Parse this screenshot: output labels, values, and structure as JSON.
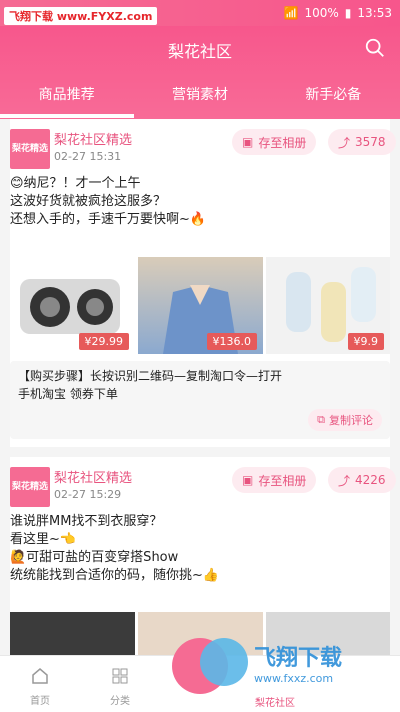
{
  "watermark": "飞翔下载 www.FYXZ.com",
  "status": {
    "battery": "100%",
    "time": "13:53"
  },
  "header": {
    "title": "梨花社区"
  },
  "tabs": [
    {
      "label": "商品推荐"
    },
    {
      "label": "营销素材"
    },
    {
      "label": "新手必备"
    }
  ],
  "posts": [
    {
      "logo": "梨花精选",
      "name": "梨花社区精选",
      "time": "02-27 15:31",
      "save_label": "存至相册",
      "share_count": "3578",
      "text_lines": [
        "😊纳尼？！才一个上午",
        "这波好货就被疯抢这服多？",
        "还想入手的，手速千万要快啊~🔥"
      ],
      "prices": [
        "¥29.99",
        "¥136.0",
        "¥9.9"
      ],
      "steps_line1": "【购买步骤】长按识别二维码—复制淘口令—打开",
      "steps_line2": "手机淘宝 领券下单",
      "copy_comment": "复制评论"
    },
    {
      "logo": "梨花精选",
      "name": "梨花社区精选",
      "time": "02-27 15:29",
      "save_label": "存至相册",
      "share_count": "4226",
      "text_lines": [
        "谁说胖MM找不到衣服穿？",
        "看这里~👈",
        "🙋可甜可盐的百变穿搭Show",
        "统统能找到合适你的码，随你挑~👍"
      ]
    }
  ],
  "bottom_nav": [
    {
      "label": "首页"
    },
    {
      "label": "分类"
    },
    {
      "label": "梨花社区"
    }
  ],
  "overlay_watermark": {
    "logo": "飞翔下载",
    "url": "www.fxxz.com"
  },
  "colors": {
    "primary": "#f7578c",
    "accent": "#e8547f",
    "price": "#e65a5a"
  }
}
